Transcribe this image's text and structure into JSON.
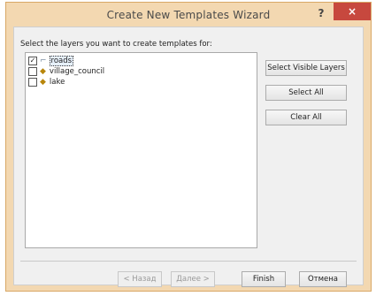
{
  "window": {
    "title": "Create New Templates Wizard",
    "help_label": "?",
    "close_label": "×"
  },
  "instruction": "Select the layers you want to create templates for:",
  "layers": [
    {
      "name": "roads",
      "checked": true,
      "icon": "line-layer-icon",
      "selected": true
    },
    {
      "name": "village_council",
      "checked": false,
      "icon": "polygon-layer-icon",
      "selected": false
    },
    {
      "name": "lake",
      "checked": false,
      "icon": "polygon-layer-icon",
      "selected": false
    }
  ],
  "side_buttons": {
    "select_visible": "Select Visible Layers",
    "select_all": "Select All",
    "clear_all": "Clear All"
  },
  "footer_buttons": {
    "back": "< Назад",
    "next": "Далее >",
    "finish": "Finish",
    "cancel": "Отмена"
  },
  "colors": {
    "title_bar": "#f3d8b1",
    "close_button": "#c7483e",
    "dialog_background": "#f0f0f0"
  }
}
